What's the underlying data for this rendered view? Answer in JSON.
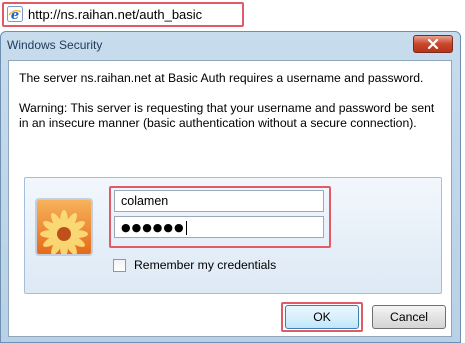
{
  "browser": {
    "address": "http://ns.raihan.net/auth_basic"
  },
  "dialog": {
    "title": "Windows Security",
    "message": "The server ns.raihan.net at Basic Auth requires a username and password.",
    "warning": "Warning: This server is requesting that your username and password be sent in an insecure manner (basic authentication without a secure connection).",
    "username": "colamen",
    "password_masked": "●●●●●●",
    "remember_label": "Remember my credentials",
    "remember_checked": false,
    "ok_label": "OK",
    "cancel_label": "Cancel"
  },
  "icons": {
    "browser": "internet-explorer-icon",
    "close": "close-icon",
    "user": "user-flower-avatar-icon"
  },
  "colors": {
    "highlight": "#e05a67",
    "titlebar": "#c7dced",
    "close_button": "#c9462c"
  }
}
